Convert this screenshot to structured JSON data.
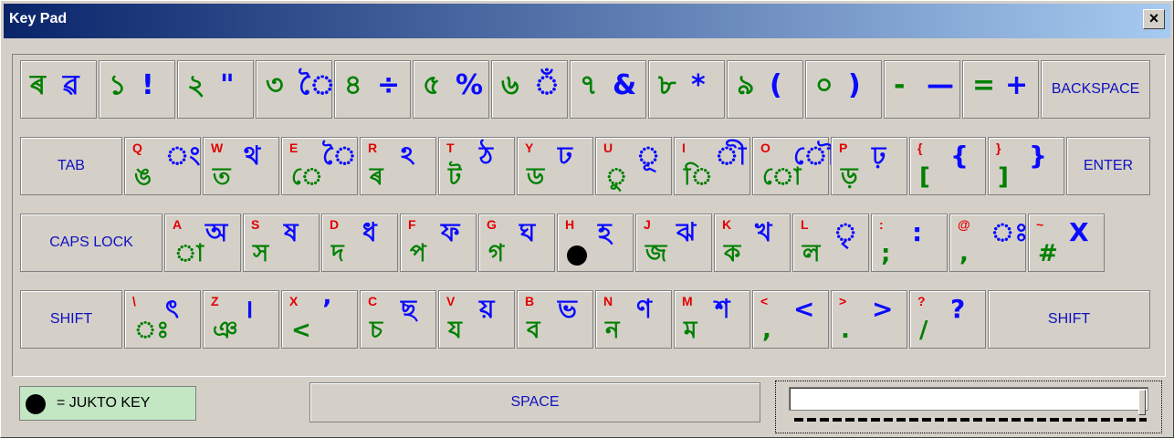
{
  "window": {
    "title": "Key Pad",
    "close": "×"
  },
  "rows": [
    [
      {
        "w": 84,
        "tl": "",
        "tr": "",
        "bl": "",
        "br": "",
        "big": [
          [
            "ৰ",
            "green"
          ],
          [
            "ৱ",
            "blue"
          ]
        ]
      },
      {
        "w": 84,
        "big": [
          [
            "১",
            "green"
          ],
          [
            "!",
            "blue"
          ]
        ]
      },
      {
        "w": 84,
        "big": [
          [
            "২",
            "green"
          ],
          [
            "\"",
            "blue"
          ]
        ]
      },
      {
        "w": 84,
        "big": [
          [
            "৩",
            "green"
          ],
          [
            "ৈ",
            "blue"
          ]
        ]
      },
      {
        "w": 84,
        "big": [
          [
            "৪",
            "green"
          ],
          [
            "÷",
            "blue"
          ]
        ]
      },
      {
        "w": 84,
        "big": [
          [
            "৫",
            "green"
          ],
          [
            "%",
            "blue"
          ]
        ]
      },
      {
        "w": 84,
        "big": [
          [
            "৬",
            "green"
          ],
          [
            "ঁ",
            "blue"
          ]
        ]
      },
      {
        "w": 84,
        "big": [
          [
            "৭",
            "green"
          ],
          [
            "&",
            "blue"
          ]
        ]
      },
      {
        "w": 84,
        "big": [
          [
            "৮",
            "green"
          ],
          [
            "*",
            "blue"
          ]
        ]
      },
      {
        "w": 84,
        "big": [
          [
            "৯",
            "green"
          ],
          [
            "(",
            "blue"
          ]
        ]
      },
      {
        "w": 84,
        "big": [
          [
            "০",
            "green"
          ],
          [
            ")",
            "blue"
          ]
        ]
      },
      {
        "w": 84,
        "big": [
          [
            "-",
            "green"
          ],
          [
            "—",
            "blue"
          ]
        ]
      },
      {
        "w": 84,
        "big": [
          [
            "=",
            "green"
          ],
          [
            "+",
            "blue"
          ]
        ]
      },
      {
        "w": 120,
        "fn": "BACKSPACE"
      }
    ],
    [
      {
        "w": 112,
        "fn": "TAB"
      },
      {
        "w": 84,
        "key": "Q",
        "up": "ং",
        "low": "ঙ"
      },
      {
        "w": 84,
        "key": "W",
        "up": "থ",
        "low": "ত"
      },
      {
        "w": 84,
        "key": "E",
        "up": "ৈ",
        "low": "ে"
      },
      {
        "w": 84,
        "key": "R",
        "up": "ঽ",
        "low": "ৰ"
      },
      {
        "w": 84,
        "key": "T",
        "up": "ঠ",
        "low": "ট"
      },
      {
        "w": 84,
        "key": "Y",
        "up": "ঢ",
        "low": "ড"
      },
      {
        "w": 84,
        "key": "U",
        "up": "ূ",
        "low": "ু"
      },
      {
        "w": 84,
        "key": "I",
        "up": "ী",
        "low": "ি"
      },
      {
        "w": 84,
        "key": "O",
        "up": "ৌ",
        "low": "ো"
      },
      {
        "w": 84,
        "key": "P",
        "up": "ঢ়",
        "low": "ড়"
      },
      {
        "w": 84,
        "key": "{",
        "up": "{",
        "low": "["
      },
      {
        "w": 84,
        "key": "}",
        "up": "}",
        "low": "]"
      },
      {
        "w": 92,
        "fn": "ENTER"
      }
    ],
    [
      {
        "w": 156,
        "fn": "CAPS LOCK"
      },
      {
        "w": 84,
        "key": "A",
        "up": "অ",
        "low": "া"
      },
      {
        "w": 84,
        "key": "S",
        "up": "ষ",
        "low": "স"
      },
      {
        "w": 84,
        "key": "D",
        "up": "ধ",
        "low": "দ"
      },
      {
        "w": 84,
        "key": "F",
        "up": "ফ",
        "low": "প"
      },
      {
        "w": 84,
        "key": "G",
        "up": "ঘ",
        "low": "গ"
      },
      {
        "w": 84,
        "key": "H",
        "up": "হ",
        "low": "dot"
      },
      {
        "w": 84,
        "key": "J",
        "up": "ঝ",
        "low": "জ"
      },
      {
        "w": 84,
        "key": "K",
        "up": "খ",
        "low": "ক"
      },
      {
        "w": 84,
        "key": "L",
        "up": "ৃ",
        "low": "ল"
      },
      {
        "w": 84,
        "key": ":",
        "up": ":",
        "low": ";"
      },
      {
        "w": 84,
        "key": "@",
        "up": "ঃ",
        "low": ","
      },
      {
        "w": 84,
        "key": "~",
        "up": "X",
        "low": "#"
      }
    ],
    [
      {
        "w": 112,
        "fn": "SHIFT"
      },
      {
        "w": 84,
        "key": "\\",
        "up": "ৎ",
        "low": "ঃ"
      },
      {
        "w": 84,
        "key": "Z",
        "up": "।",
        "low": "ঞ"
      },
      {
        "w": 84,
        "key": "X",
        "up": "ʼ",
        "low": "<"
      },
      {
        "w": 84,
        "key": "C",
        "up": "ছ",
        "low": "চ"
      },
      {
        "w": 84,
        "key": "V",
        "up": "য়",
        "low": "য"
      },
      {
        "w": 84,
        "key": "B",
        "up": "ভ",
        "low": "ব"
      },
      {
        "w": 84,
        "key": "N",
        "up": "ণ",
        "low": "ন"
      },
      {
        "w": 84,
        "key": "M",
        "up": "শ",
        "low": "ম"
      },
      {
        "w": 84,
        "key": "<",
        "up": "<",
        "low": ","
      },
      {
        "w": 84,
        "key": ">",
        "up": ">",
        "low": "."
      },
      {
        "w": 84,
        "key": "?",
        "up": "?",
        "low": "/"
      },
      {
        "w": 178,
        "fn": "SHIFT"
      }
    ]
  ],
  "legend": {
    "label": "= JUKTO KEY"
  },
  "space": {
    "label": "SPACE"
  },
  "slider": {
    "value": 1.0
  }
}
